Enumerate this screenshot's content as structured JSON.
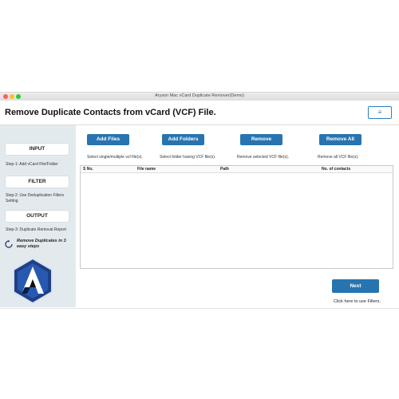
{
  "window": {
    "title": "Aryson Mac vCard Duplicate Remover(Demo)"
  },
  "header": {
    "heading": "Remove Duplicate Contacts from vCard (VCF) File.",
    "menu_icon": "hamburger-icon"
  },
  "sidebar": {
    "steps": [
      {
        "label": "INPUT",
        "desc": "Step-1: Add vCard File/Folder"
      },
      {
        "label": "FILTER",
        "desc": "Step-2: Use Deduplication Filters Setting"
      },
      {
        "label": "OUTPUT",
        "desc": "Step-3: Duplicate Removal Report"
      }
    ],
    "tagline": "Remove Duplicates in 3 easy steps",
    "logo_icon": "aryson-logo-icon"
  },
  "actions": [
    {
      "label": "Add Files",
      "desc": "Select single/multiple vcf file(s)."
    },
    {
      "label": "Add Folders",
      "desc": "Select folder having VCF file(s)."
    },
    {
      "label": "Remove",
      "desc": "Remove selected VCF file(s)."
    },
    {
      "label": "Remove All",
      "desc": "Remove all VCF file(s)."
    }
  ],
  "table": {
    "columns": [
      "S No.",
      "File name",
      "Path",
      "No. of contacts"
    ],
    "rows": []
  },
  "footer": {
    "next_label": "Next",
    "next_desc": "Click here to use Filters."
  },
  "colors": {
    "accent": "#2774b0",
    "sidebar_bg": "#e3eaee"
  }
}
